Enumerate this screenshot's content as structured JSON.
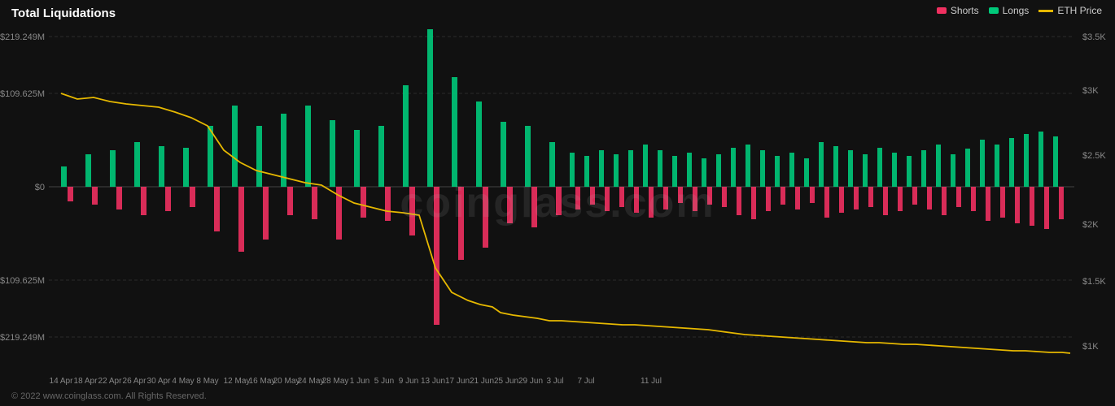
{
  "title": "Total Liquidations",
  "legend": {
    "shorts_label": "Shorts",
    "longs_label": "Longs",
    "eth_label": "ETH Price",
    "shorts_color": "#f03060",
    "longs_color": "#00c97a",
    "eth_color": "#e6b800"
  },
  "watermark": "coinglass.com",
  "footer": "© 2022 www.coinglass.com. All Rights Reserved.",
  "y_axis_left": [
    "$219.249M",
    "$109.625M",
    "$0",
    "$109.625M",
    "$219.249M"
  ],
  "y_axis_right": [
    "$3.5K",
    "$3K",
    "$2.5K",
    "$2K",
    "$1.5K",
    "$1K"
  ],
  "x_axis": [
    "14 Apr",
    "18 Apr",
    "22 Apr",
    "26 Apr",
    "30 Apr",
    "4 May",
    "8 May",
    "12 May",
    "16 May",
    "20 May",
    "24 May",
    "28 May",
    "1 Jun",
    "5 Jun",
    "9 Jun",
    "13 Jun",
    "17 Jun",
    "21 Jun",
    "25 Jun",
    "29 Jun",
    "3 Jul",
    "7 Jul",
    "11 Jul"
  ]
}
